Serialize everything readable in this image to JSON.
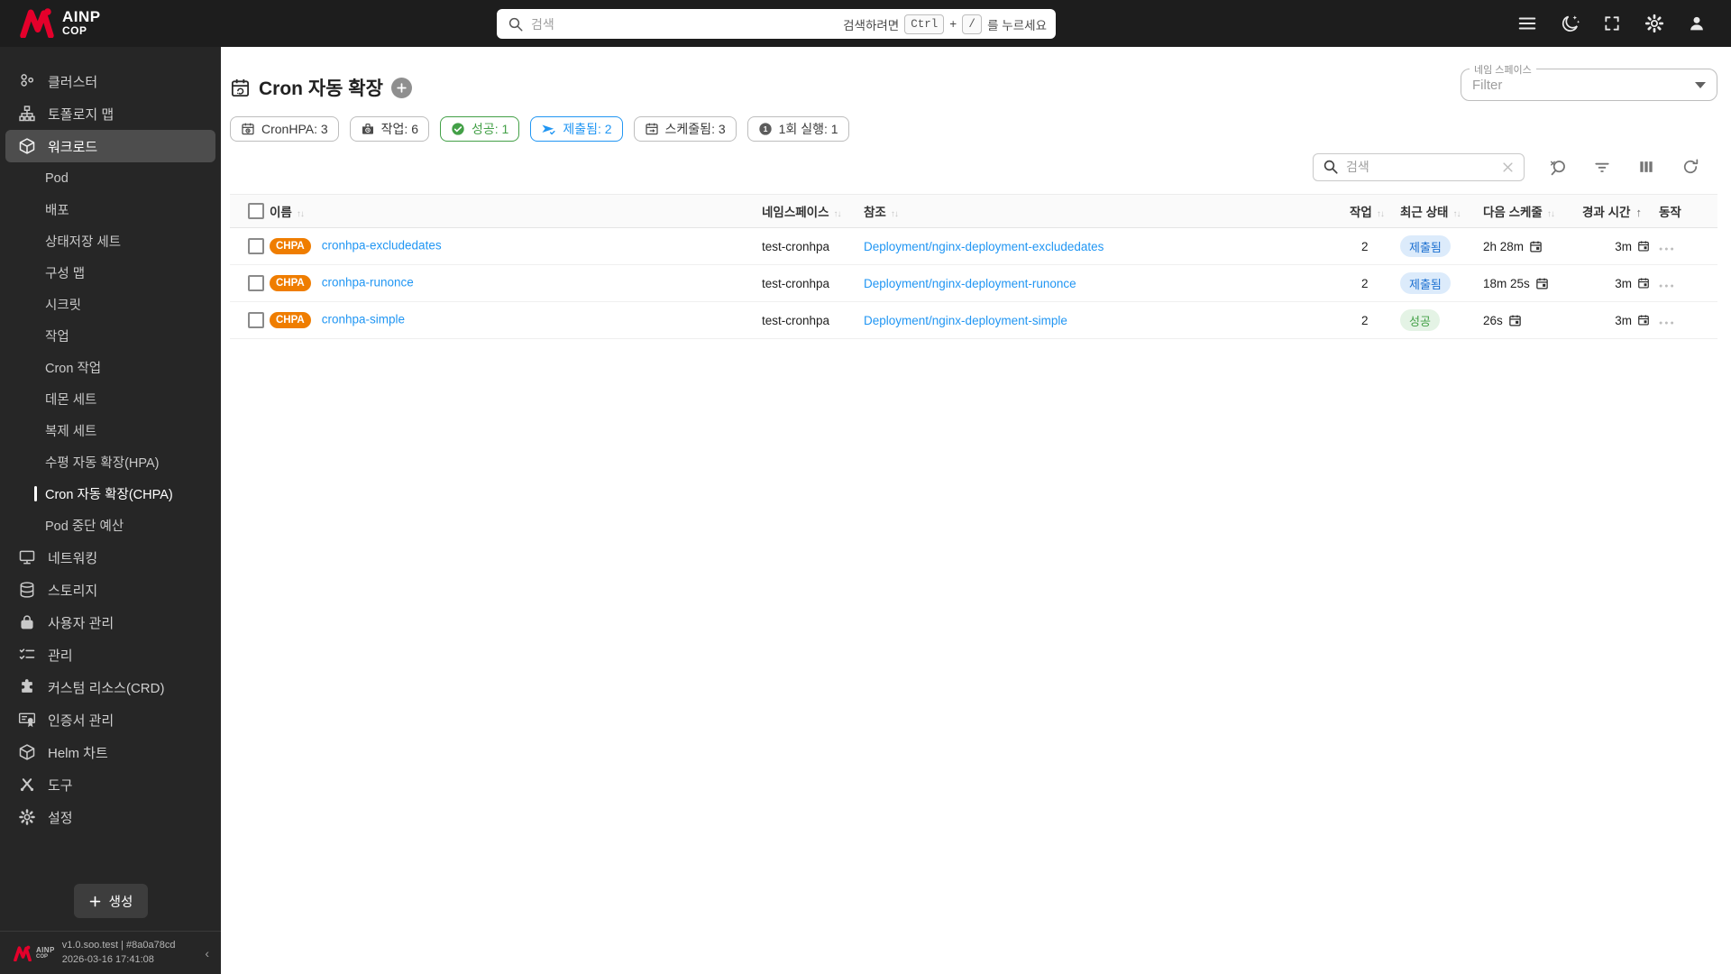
{
  "topbar": {
    "logo_line1": "AINP",
    "logo_line2": "COP",
    "search_placeholder": "검색",
    "search_hint_prefix": "검색하려면",
    "search_hint_key1": "Ctrl",
    "search_hint_plus": "+",
    "search_hint_key2": "/",
    "search_hint_suffix": "를 누르세요"
  },
  "sidebar": {
    "top_items": [
      {
        "label": "클러스터"
      },
      {
        "label": "토폴로지 맵"
      },
      {
        "label": "워크로드"
      }
    ],
    "workload_children": [
      {
        "label": "Pod"
      },
      {
        "label": "배포"
      },
      {
        "label": "상태저장 세트"
      },
      {
        "label": "구성 맵"
      },
      {
        "label": "시크릿"
      },
      {
        "label": "작업"
      },
      {
        "label": "Cron 작업"
      },
      {
        "label": "데몬 세트"
      },
      {
        "label": "복제 세트"
      },
      {
        "label": "수평 자동 확장(HPA)"
      },
      {
        "label": "Cron 자동 확장(CHPA)"
      },
      {
        "label": "Pod 중단 예산"
      }
    ],
    "bottom_items": [
      {
        "label": "네트워킹"
      },
      {
        "label": "스토리지"
      },
      {
        "label": "사용자 관리"
      },
      {
        "label": "관리"
      },
      {
        "label": "커스텀 리소스(CRD)"
      },
      {
        "label": "인증서 관리"
      },
      {
        "label": "Helm 차트"
      },
      {
        "label": "도구"
      },
      {
        "label": "설정"
      }
    ],
    "create_button": "생성",
    "footer_version": "v1.0.soo.test | #8a0a78cd",
    "footer_timestamp": "2026-03-16 17:41:08",
    "collapse_glyph": "‹"
  },
  "page": {
    "title": "Cron 자동 확장",
    "namespace_filter_label": "네임 스페이스",
    "namespace_filter_placeholder": "Filter",
    "summary_chips": [
      {
        "label": "CronHPA: 3",
        "variant": "default"
      },
      {
        "label": "작업: 6",
        "variant": "default"
      },
      {
        "label": "성공: 1",
        "variant": "success"
      },
      {
        "label": "제출됨: 2",
        "variant": "info"
      },
      {
        "label": "스케줄됨: 3",
        "variant": "default"
      },
      {
        "label": "1회 실행: 1",
        "variant": "default"
      }
    ],
    "table_search_placeholder": "검색",
    "table": {
      "headers": [
        "이름",
        "네임스페이스",
        "참조",
        "작업",
        "최근 상태",
        "다음 스케줄",
        "경과 시간",
        "동작"
      ],
      "rows": [
        {
          "badge": "CHPA",
          "name": "cronhpa-excludedates",
          "namespace": "test-cronhpa",
          "reference": "Deployment/nginx-deployment-excludedates",
          "jobs": "2",
          "status": "제출됨",
          "status_variant": "info",
          "next_schedule": "2h 28m",
          "elapsed": "3m"
        },
        {
          "badge": "CHPA",
          "name": "cronhpa-runonce",
          "namespace": "test-cronhpa",
          "reference": "Deployment/nginx-deployment-runonce",
          "jobs": "2",
          "status": "제출됨",
          "status_variant": "info",
          "next_schedule": "18m 25s",
          "elapsed": "3m"
        },
        {
          "badge": "CHPA",
          "name": "cronhpa-simple",
          "namespace": "test-cronhpa",
          "reference": "Deployment/nginx-deployment-simple",
          "jobs": "2",
          "status": "성공",
          "status_variant": "success",
          "next_schedule": "26s",
          "elapsed": "3m"
        }
      ]
    }
  },
  "colors": {
    "brand_red": "#e4002b",
    "accent_orange": "#ef7d00",
    "link_blue": "#2196f3",
    "success_green": "#43a047",
    "info_text_blue": "#1b6fd0",
    "topbar_bg": "#1d1d1d",
    "sidebar_bg": "#262626"
  }
}
